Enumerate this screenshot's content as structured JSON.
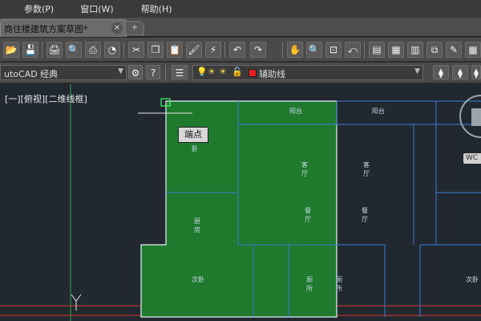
{
  "menubar": {
    "items": [
      "参数(P)",
      "窗口(W)",
      "帮助(H)"
    ]
  },
  "tabs": {
    "active_label": "商住楼建筑方案草图*",
    "close_icon": "×",
    "new_tab_icon": "+"
  },
  "workspace": {
    "name": "utoCAD 经典"
  },
  "layer": {
    "name": "辅助线",
    "color": "#e82020"
  },
  "viewport": {
    "label": "[一][俯视][二维线框]"
  },
  "tooltip": {
    "text": "端点"
  },
  "viewcube": {
    "wcs": "WC"
  },
  "rooms": [
    {
      "id": "balcony-1",
      "label": "阳台"
    },
    {
      "id": "balcony-2",
      "label": "阳台"
    },
    {
      "id": "bedroom-1",
      "label": "卧"
    },
    {
      "id": "living-1",
      "label": "客厅"
    },
    {
      "id": "living-2",
      "label": "客厅"
    },
    {
      "id": "kitchen",
      "label": "厨房"
    },
    {
      "id": "dining-1",
      "label": "餐厅"
    },
    {
      "id": "dining-2",
      "label": "餐厅"
    },
    {
      "id": "bedroom-2",
      "label": "次卧"
    },
    {
      "id": "bath-1",
      "label": "厕所"
    },
    {
      "id": "bath-2",
      "label": "厕所"
    },
    {
      "id": "bedroom-3",
      "label": "次卧"
    }
  ],
  "colors": {
    "canvas_bg": "#212830",
    "highlight_fill": "#1f7a2e",
    "wall_line": "#3a7bd5",
    "selected_outline": "#e8f0ff",
    "axis_red": "#d83a2a",
    "axis_green": "#2fa44a"
  }
}
